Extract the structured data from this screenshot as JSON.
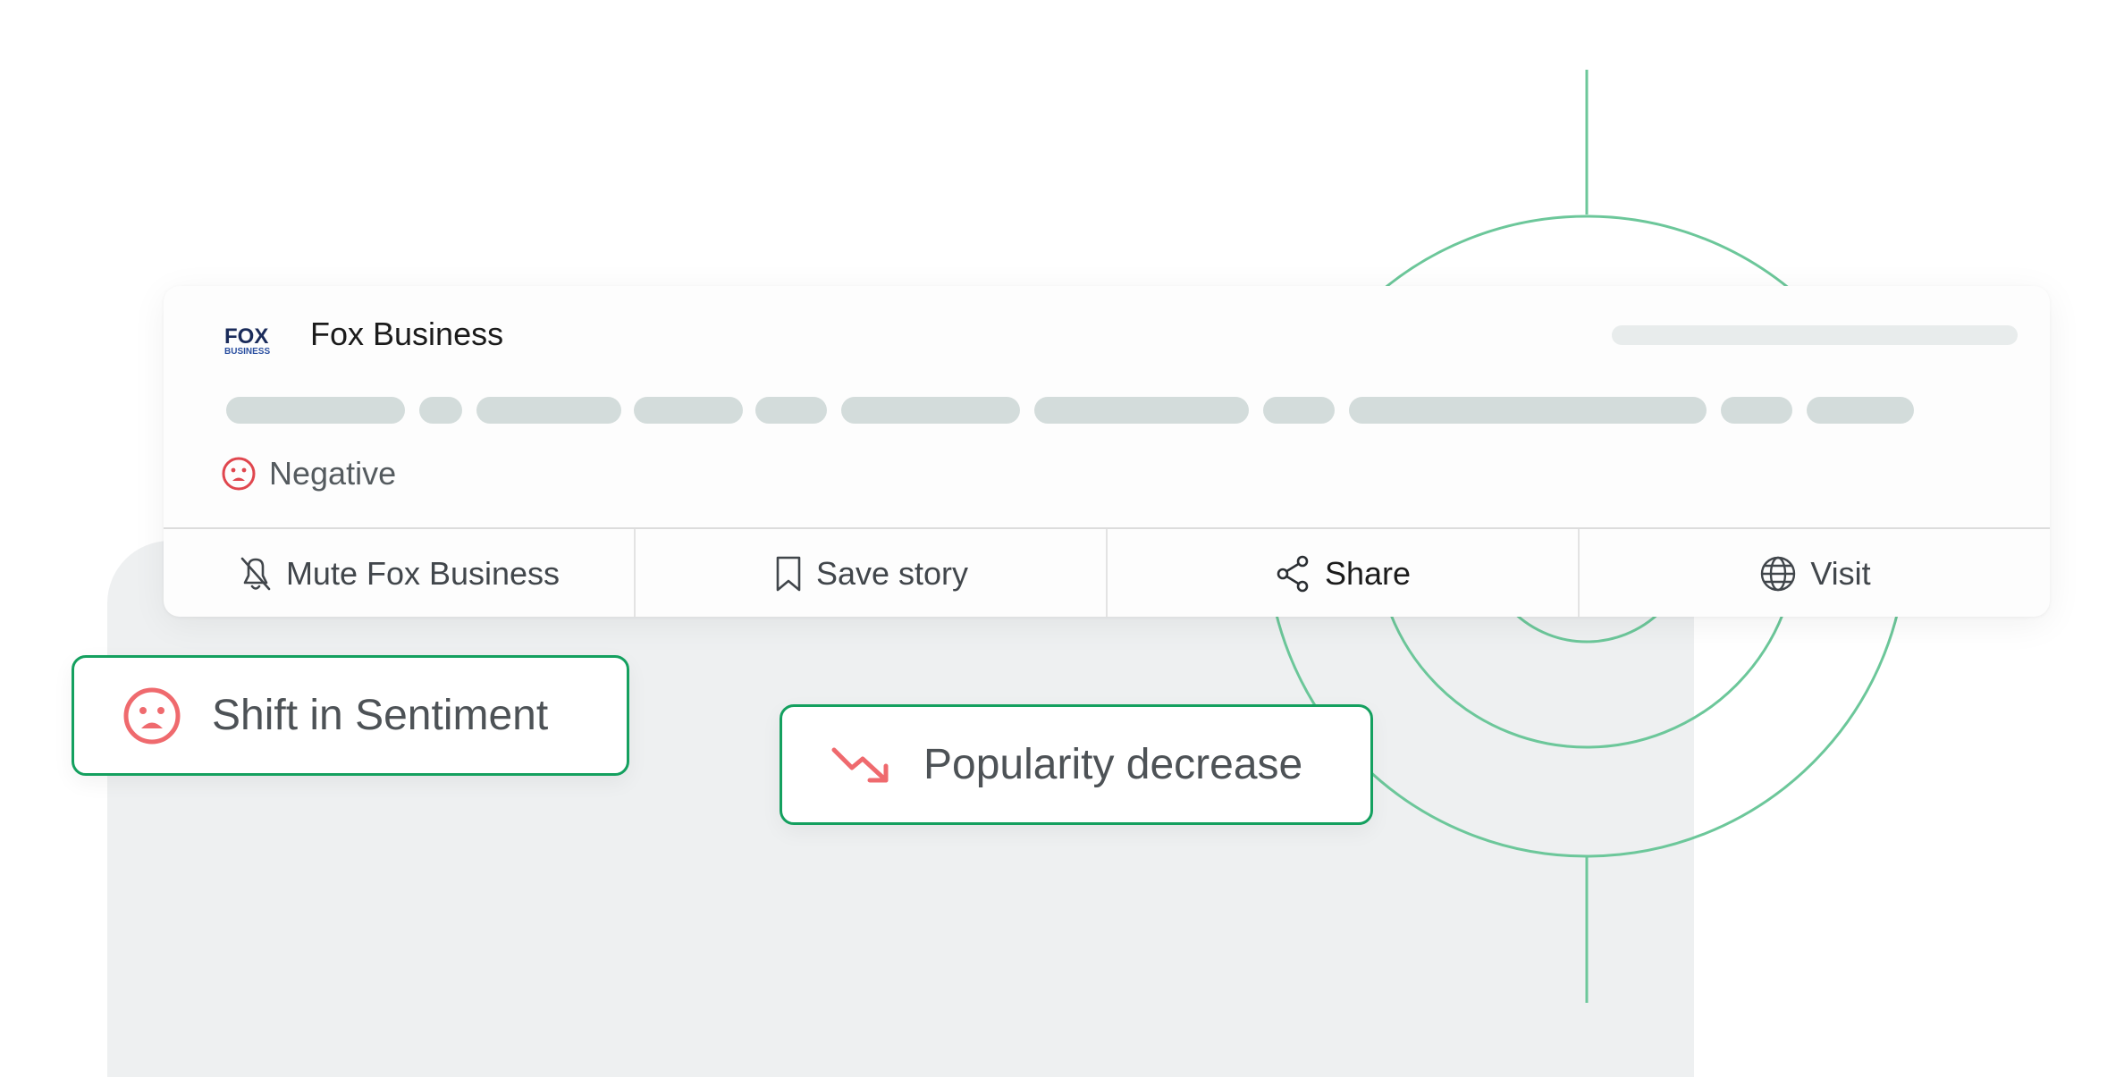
{
  "story_card": {
    "source": {
      "name": "Fox Business",
      "logo_text_top": "FOX",
      "logo_text_bottom": "BUSINESS"
    },
    "sentiment": {
      "label": "Negative",
      "icon": "sad-face-icon",
      "color": "#e0464e"
    },
    "actions": [
      {
        "label": "Mute Fox Business",
        "icon": "bell-off-icon"
      },
      {
        "label": "Save story",
        "icon": "bookmark-icon"
      },
      {
        "label": "Share",
        "icon": "share-icon"
      },
      {
        "label": "Visit",
        "icon": "globe-icon"
      }
    ]
  },
  "alerts": [
    {
      "label": "Shift in Sentiment",
      "icon": "sad-face-icon"
    },
    {
      "label": "Popularity decrease",
      "icon": "trending-down-icon"
    }
  ],
  "colors": {
    "accent_green": "#14a05f",
    "target_line_green": "#6cc79a",
    "negative_red": "#e0464e",
    "chip_icon_red": "#ef6a6e",
    "skeleton_grey": "#d3dcdb",
    "panel_grey": "#eef0f1"
  }
}
